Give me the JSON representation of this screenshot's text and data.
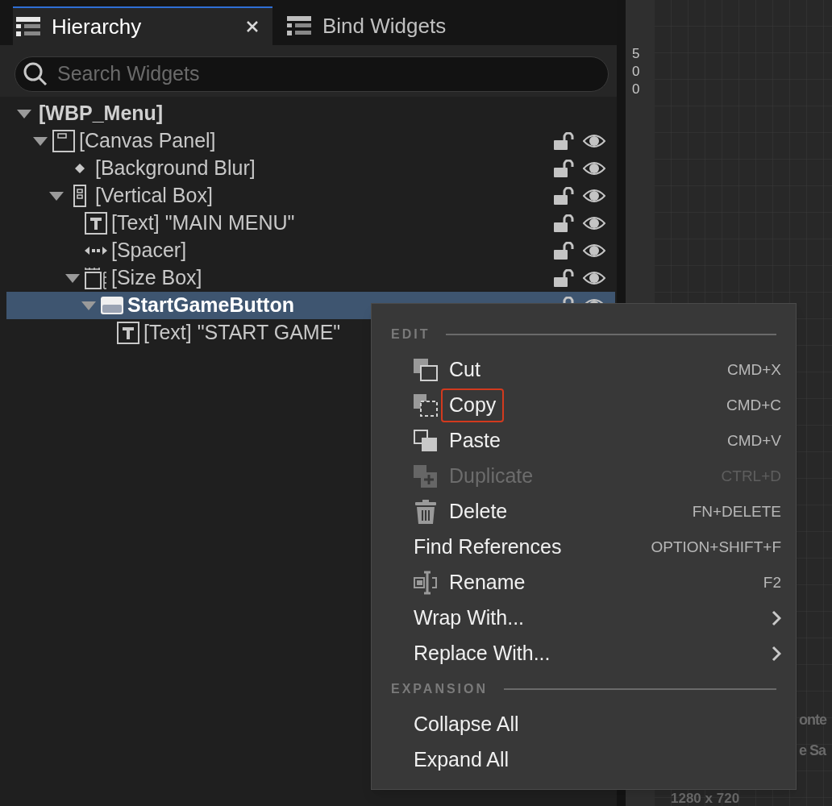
{
  "tabs": [
    {
      "label": "Hierarchy",
      "selected": true,
      "closable": true
    },
    {
      "label": "Bind Widgets",
      "selected": false,
      "closable": false
    }
  ],
  "search": {
    "placeholder": "Search Widgets"
  },
  "tree": [
    {
      "label": "[WBP_Menu]",
      "kind": "root",
      "expanded": true,
      "selected": false,
      "children": [
        {
          "label": "[Canvas Panel]",
          "kind": "canvas",
          "expanded": true,
          "selected": false,
          "children": [
            {
              "label": "[Background Blur]",
              "kind": "blur",
              "selected": false
            },
            {
              "label": "[Vertical Box]",
              "kind": "vbox",
              "expanded": true,
              "selected": false,
              "children": [
                {
                  "label": "[Text] \"MAIN MENU\"",
                  "kind": "text",
                  "selected": false
                },
                {
                  "label": "[Spacer]",
                  "kind": "spacer",
                  "selected": false
                },
                {
                  "label": "[Size Box]",
                  "kind": "sizebox",
                  "expanded": true,
                  "selected": false,
                  "children": [
                    {
                      "label": "StartGameButton",
                      "kind": "button",
                      "expanded": true,
                      "selected": true,
                      "children": [
                        {
                          "label": "[Text] \"START GAME\"",
                          "kind": "text",
                          "selected": false
                        }
                      ]
                    }
                  ]
                }
              ]
            }
          ]
        }
      ]
    }
  ],
  "ruler": {
    "label": "500"
  },
  "canvas_texts": [
    "onte",
    "e Sa",
    "1280 x 720"
  ],
  "menu": {
    "sections": [
      {
        "title": "EDIT",
        "items": [
          {
            "label": "Cut",
            "kind": "cut",
            "shortcut": "CMD+X",
            "disabled": false,
            "highlighted": false
          },
          {
            "label": "Copy",
            "kind": "copy",
            "shortcut": "CMD+C",
            "disabled": false,
            "highlighted": true
          },
          {
            "label": "Paste",
            "kind": "paste",
            "shortcut": "CMD+V",
            "disabled": false,
            "highlighted": false
          },
          {
            "label": "Duplicate",
            "kind": "duplicate",
            "shortcut": "CTRL+D",
            "disabled": true,
            "highlighted": false
          },
          {
            "label": "Delete",
            "kind": "delete",
            "shortcut": "FN+DELETE",
            "disabled": false,
            "highlighted": false
          },
          {
            "label": "Find References",
            "kind": "plain",
            "shortcut": "OPTION+SHIFT+F",
            "disabled": false,
            "highlighted": false
          },
          {
            "label": "Rename",
            "kind": "rename",
            "shortcut": "F2",
            "disabled": false,
            "highlighted": false
          },
          {
            "label": "Wrap With...",
            "kind": "plain",
            "submenu": true,
            "disabled": false,
            "highlighted": false
          },
          {
            "label": "Replace With...",
            "kind": "plain",
            "submenu": true,
            "disabled": false,
            "highlighted": false
          }
        ]
      },
      {
        "title": "EXPANSION",
        "items": [
          {
            "label": "Collapse All",
            "kind": "plain",
            "disabled": false,
            "highlighted": false
          },
          {
            "label": "Expand All",
            "kind": "plain",
            "disabled": false,
            "highlighted": false
          }
        ]
      }
    ]
  }
}
